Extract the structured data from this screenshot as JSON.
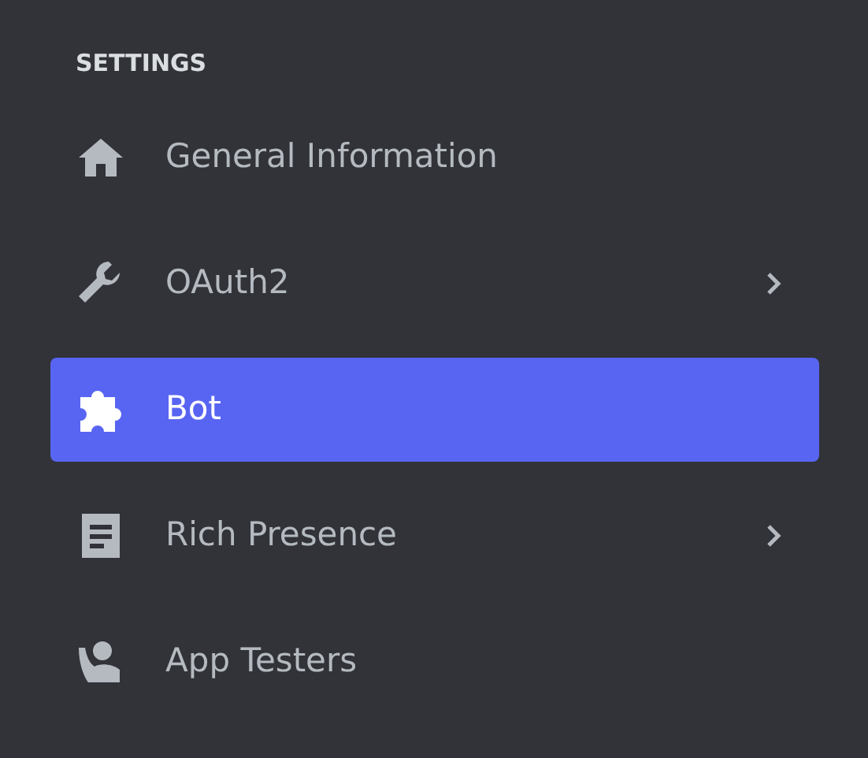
{
  "section": {
    "title": "SETTINGS"
  },
  "items": [
    {
      "label": "General Information",
      "selected": false,
      "expandable": false
    },
    {
      "label": "OAuth2",
      "selected": false,
      "expandable": true
    },
    {
      "label": "Bot",
      "selected": true,
      "expandable": false
    },
    {
      "label": "Rich Presence",
      "selected": false,
      "expandable": true
    },
    {
      "label": "App Testers",
      "selected": false,
      "expandable": false
    }
  ]
}
